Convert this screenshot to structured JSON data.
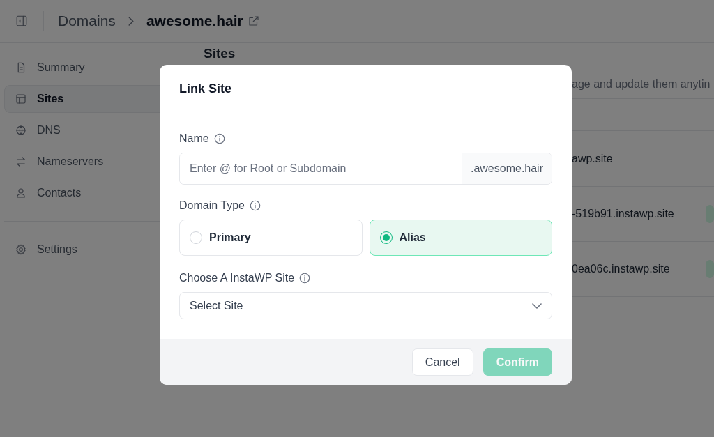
{
  "topbar": {
    "breadcrumb": [
      {
        "label": "Domains",
        "kind": "link"
      },
      {
        "label": "awesome.hair",
        "kind": "current"
      }
    ]
  },
  "sidebar": {
    "items": [
      {
        "label": "Summary",
        "selected": false
      },
      {
        "label": "Sites",
        "selected": true
      },
      {
        "label": "DNS",
        "selected": false
      },
      {
        "label": "Nameservers",
        "selected": false
      },
      {
        "label": "Contacts",
        "selected": false
      }
    ],
    "bottom_items": [
      {
        "label": "Settings",
        "selected": false
      }
    ]
  },
  "page": {
    "heading": "Sites",
    "subtitle": "age and update them anytin",
    "table": {
      "rows": [
        {
          "cell": "awp.site",
          "badge": false
        },
        {
          "cell": "-519b91.instawp.site",
          "badge": true
        },
        {
          "cell": "0ea06c.instawp.site",
          "badge": true
        }
      ]
    }
  },
  "dialog": {
    "title": "Link Site",
    "name_field": {
      "label": "Name",
      "placeholder": "Enter @ for Root or Subdomain",
      "suffix": ".awesome.hair"
    },
    "domain_type": {
      "label": "Domain Type",
      "options": [
        {
          "label": "Primary",
          "selected": false
        },
        {
          "label": "Alias",
          "selected": true
        }
      ]
    },
    "site_select": {
      "label": "Choose A InstaWP Site",
      "value": "Select Site"
    },
    "buttons": [
      {
        "label": "Cancel",
        "kind": "secondary",
        "disabled": false
      },
      {
        "label": "Confirm",
        "kind": "primary",
        "disabled": true
      }
    ]
  }
}
